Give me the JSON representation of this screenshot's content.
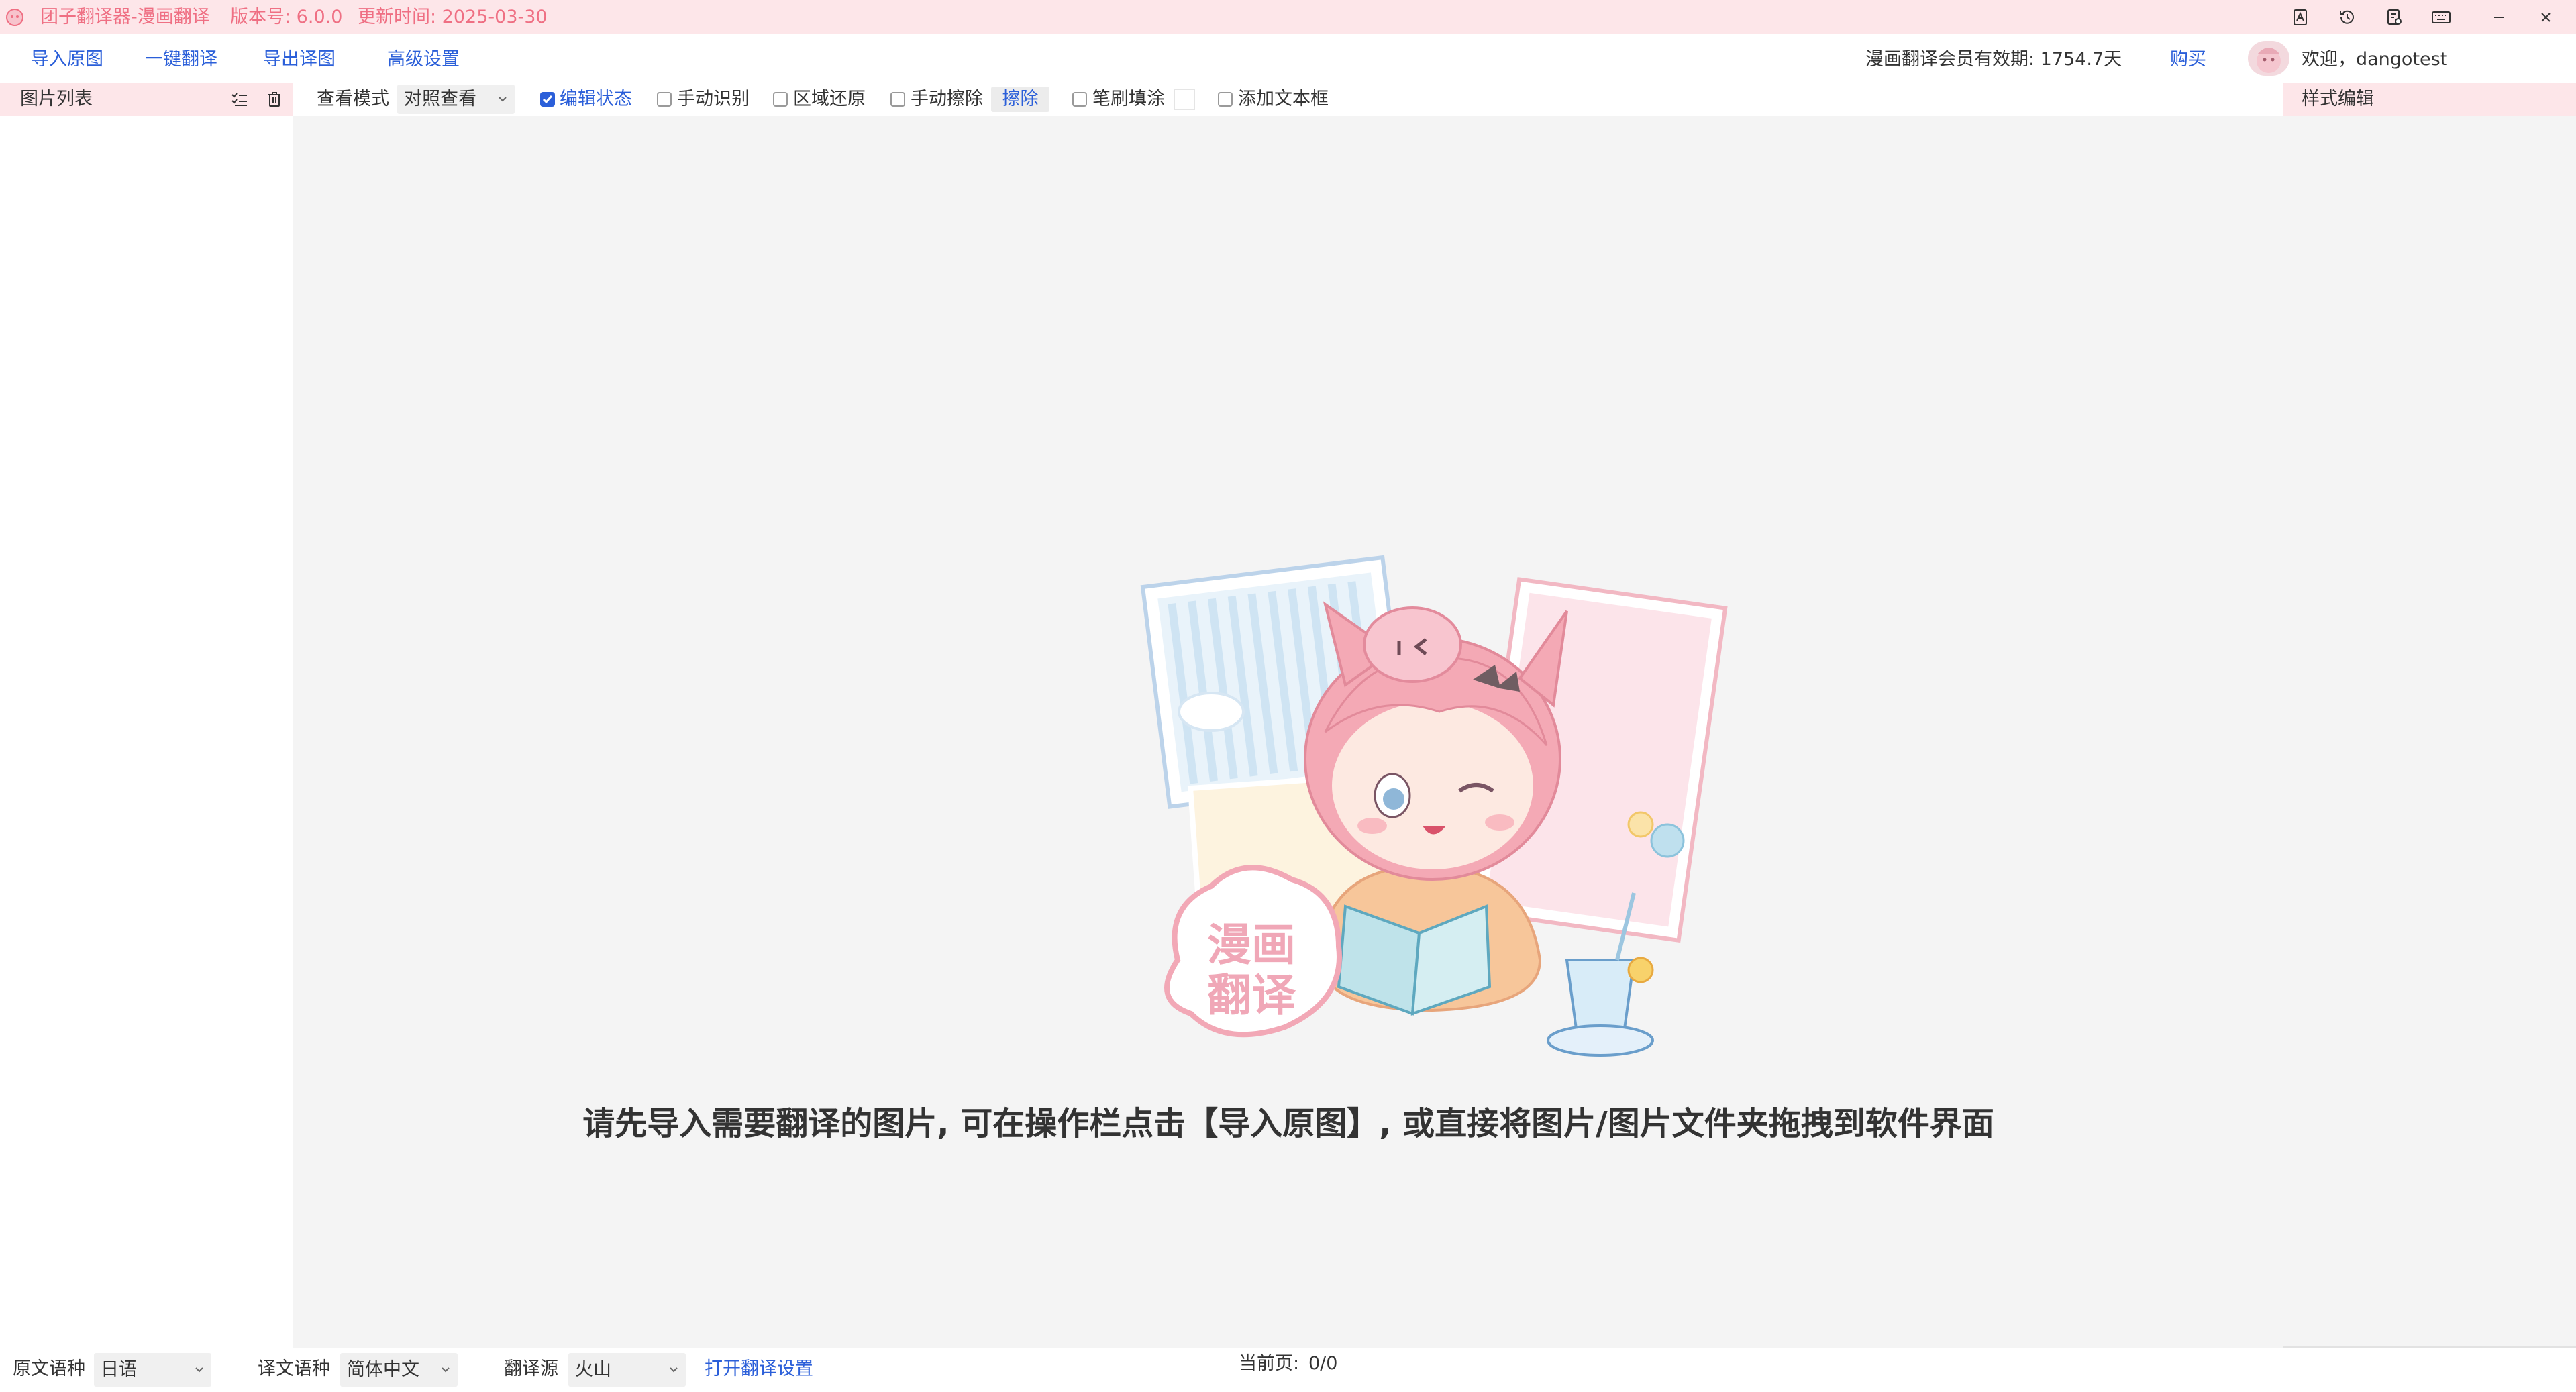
{
  "titlebar": {
    "app_name": "团子翻译器-漫画翻译",
    "version": "版本号: 6.0.0",
    "updated": "更新时间: 2025-03-30"
  },
  "menu": {
    "import": "导入原图",
    "translate": "一键翻译",
    "export": "导出译图",
    "advanced": "高级设置"
  },
  "account": {
    "membership": "漫画翻译会员有效期: 1754.7天",
    "buy": "购买",
    "welcome": "欢迎，dangotest"
  },
  "left_panel": {
    "title": "图片列表"
  },
  "toolbar": {
    "view_mode_label": "查看模式",
    "view_mode_value": "对照查看",
    "edit_state": "编辑状态",
    "manual_detect": "手动识别",
    "region_restore": "区域还原",
    "manual_erase": "手动擦除",
    "erase": "擦除",
    "brush_fill": "笔刷填涂",
    "add_textbox": "添加文本框"
  },
  "right_panel": {
    "title": "样式编辑"
  },
  "illustration": {
    "badge_line1": "漫画",
    "badge_line2": "翻译"
  },
  "main": {
    "message": "请先导入需要翻译的图片, 可在操作栏点击【导入原图】, 或直接将图片/图片文件夹拖拽到软件界面"
  },
  "bottom": {
    "source_lang_label": "原文语种",
    "source_lang": "日语",
    "target_lang_label": "译文语种",
    "target_lang": "简体中文",
    "engine_label": "翻译源",
    "engine": "火山",
    "open_settings": "打开翻译设置",
    "page_label": "当前页:",
    "page_value": "0/0"
  },
  "colors": {
    "accent": "#2b5fd9",
    "title_text": "#ef6f83",
    "header_bg": "#fde6e9",
    "canvas_bg": "#f4f4f4"
  }
}
